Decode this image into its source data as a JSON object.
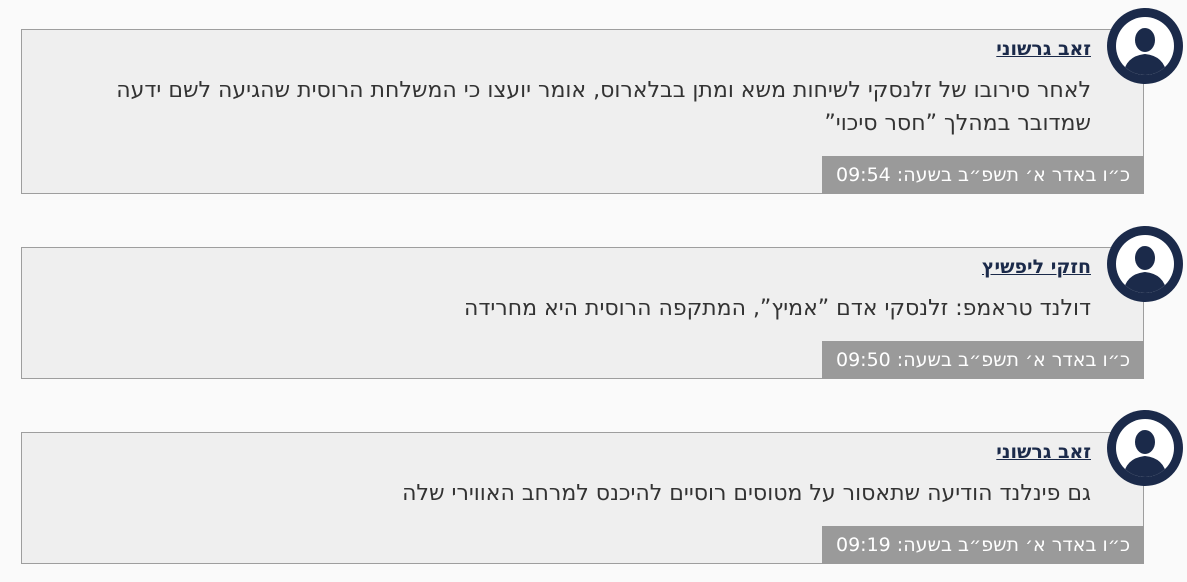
{
  "posts": [
    {
      "author": "זאב גרשוני",
      "text": "לאחר סירובו של זלנסקי לשיחות משא ומתן בבלארוס, אומר יועצו כי המשלחת הרוסית שהגיעה לשם ידעה שמדובר במהלך ”חסר סיכוי”",
      "time": "כ״ו באדר א׳ תשפ״ב בשעה: 09:54",
      "avatar_icon": "user-silhouette-icon"
    },
    {
      "author": "חזקי ליפשיץ",
      "text": "דולנד טראמפ: זלנסקי אדם ”אמיץ”, המתקפה הרוסית היא מחרידה",
      "time": "כ״ו באדר א׳ תשפ״ב בשעה: 09:50",
      "avatar_icon": "user-silhouette-icon"
    },
    {
      "author": "זאב גרשוני",
      "text": "גם פינלנד הודיעה שתאסור על מטוסים רוסיים להיכנס למרחב האווירי שלה",
      "time": "כ״ו באדר א׳ תשפ״ב בשעה: 09:19",
      "avatar_icon": "user-silhouette-icon"
    }
  ],
  "colors": {
    "avatar_bg": "#1b2a4a",
    "card_bg": "#efefef",
    "time_bg": "#9a9a9a",
    "author": "#1b2a4a"
  }
}
